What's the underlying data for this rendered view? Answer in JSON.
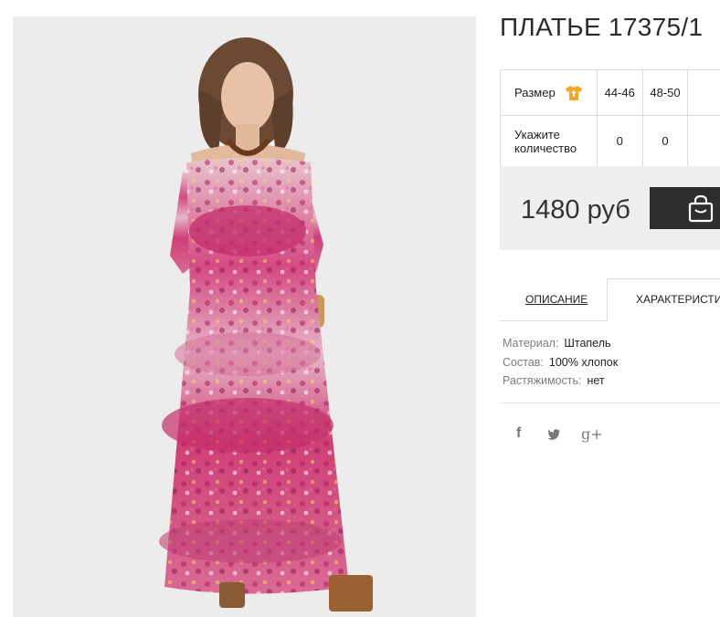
{
  "product": {
    "title": "ПЛАТЬЕ 17375/1"
  },
  "sizes": {
    "size_label": "Размер",
    "size_icon": "tshirt-size-icon",
    "columns": [
      "44-46",
      "48-50"
    ],
    "quantity_label_1": "Укажите",
    "quantity_label_2": "количество",
    "quantities": [
      "0",
      "0"
    ]
  },
  "price": {
    "text": "1480 руб",
    "cart_icon": "shopping-bag-icon"
  },
  "tabs": {
    "description": "ОПИСАНИЕ",
    "characteristics": "ХАРАКТЕРИСТИКИ"
  },
  "characteristics": [
    {
      "key": "Материал:",
      "value": "Штапель"
    },
    {
      "key": "Состав:",
      "value": "100% хлопок"
    },
    {
      "key": "Растяжимость:",
      "value": "нет"
    }
  ],
  "social": {
    "facebook": "f",
    "twitter": "twitter-icon",
    "googleplus": "g+"
  },
  "colors": {
    "photo_bg": "#ececec",
    "price_bg": "#efefef",
    "cart_button": "#2e2e2e",
    "size_icon": "#f5a623"
  }
}
